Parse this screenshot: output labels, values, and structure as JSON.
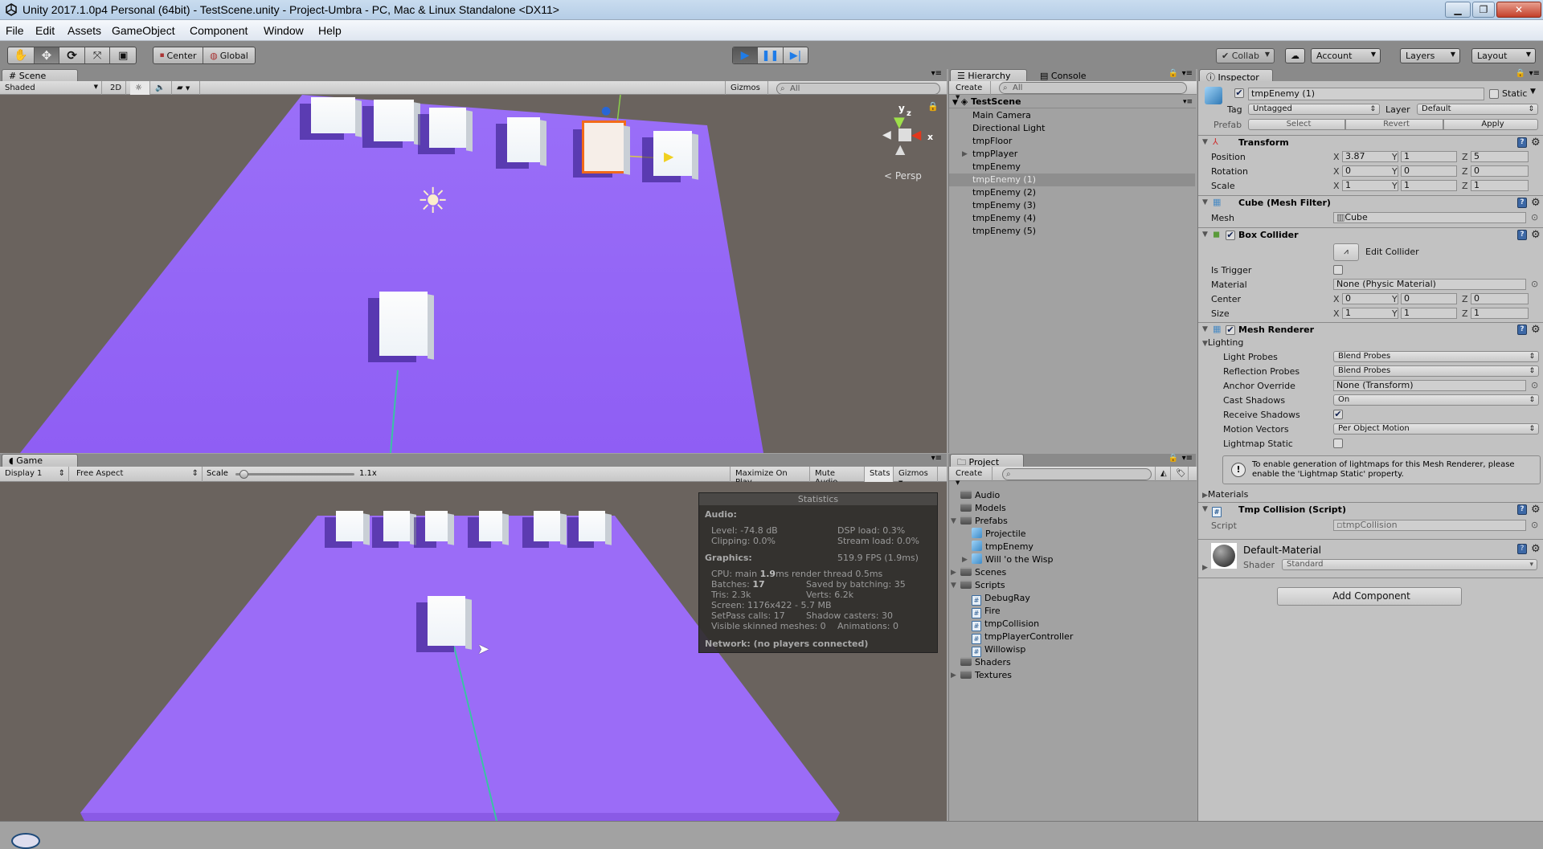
{
  "window": {
    "title": "Unity 2017.1.0p4 Personal (64bit) - TestScene.unity - Project-Umbra - PC, Mac & Linux Standalone <DX11>",
    "controls": [
      "minimize",
      "restore",
      "close"
    ]
  },
  "menu": [
    "File",
    "Edit",
    "Assets",
    "GameObject",
    "Component",
    "Window",
    "Help"
  ],
  "toolbar": {
    "transform_tools": [
      "hand-tool",
      "move-tool",
      "rotate-tool",
      "scale-tool",
      "rect-tool"
    ],
    "pivot": "Center",
    "space": "Global",
    "play": "play",
    "pause": "pause",
    "step": "step",
    "collab": "Collab",
    "account": "Account",
    "layers": "Layers",
    "layout": "Layout"
  },
  "scene": {
    "tab": "Scene",
    "shading": "Shaded",
    "mode_2d": "2D",
    "gizmos": "Gizmos",
    "search_placeholder": "All",
    "projection": "Persp",
    "axes": {
      "y": "y",
      "z": "z",
      "x": "x"
    }
  },
  "game": {
    "tab": "Game",
    "display": "Display 1",
    "aspect": "Free Aspect",
    "scale_label": "Scale",
    "scale_value": "1.1x",
    "scale_fraction": 0.05,
    "buttons": [
      "Maximize On Play",
      "Mute Audio",
      "Stats",
      "Gizmos"
    ],
    "stats": {
      "title": "Statistics",
      "audio_header": "Audio:",
      "level": "Level: -74.8 dB",
      "clipping": "Clipping: 0.0%",
      "dsp": "DSP load: 0.3%",
      "stream": "Stream load: 0.0%",
      "graphics_header": "Graphics:",
      "fps": "519.9 FPS (1.9ms)",
      "cpu_prefix": "CPU: main ",
      "cpu_main": "1.9",
      "cpu_suffix": "ms  render thread 0.5ms",
      "batches_prefix": "Batches: ",
      "batches": "17",
      "saved": "Saved by batching: 35",
      "tris": "Tris: 2.3k",
      "verts": "Verts: 6.2k",
      "screen": "Screen: 1176x422 - 5.7 MB",
      "setpass": "SetPass calls: 17",
      "shadow": "Shadow casters: 30",
      "skinned": "Visible skinned meshes: 0",
      "animations": "Animations: 0",
      "network": "Network: (no players connected)"
    }
  },
  "hierarchy": {
    "tab": "Hierarchy",
    "console_tab": "Console",
    "create": "Create",
    "search_placeholder": "All",
    "scene_name": "TestScene",
    "items": [
      {
        "label": "Main Camera",
        "expandable": false,
        "selected": false
      },
      {
        "label": "Directional Light",
        "expandable": false,
        "selected": false
      },
      {
        "label": "tmpFloor",
        "expandable": false,
        "selected": false
      },
      {
        "label": "tmpPlayer",
        "expandable": true,
        "selected": false
      },
      {
        "label": "tmpEnemy",
        "expandable": false,
        "selected": false
      },
      {
        "label": "tmpEnemy (1)",
        "expandable": false,
        "selected": true
      },
      {
        "label": "tmpEnemy (2)",
        "expandable": false,
        "selected": false
      },
      {
        "label": "tmpEnemy (3)",
        "expandable": false,
        "selected": false
      },
      {
        "label": "tmpEnemy (4)",
        "expandable": false,
        "selected": false
      },
      {
        "label": "tmpEnemy (5)",
        "expandable": false,
        "selected": false
      }
    ]
  },
  "project": {
    "tab": "Project",
    "create": "Create",
    "items": [
      {
        "label": "Audio",
        "type": "folder",
        "depth": 0,
        "arrow": ""
      },
      {
        "label": "Models",
        "type": "folder",
        "depth": 0,
        "arrow": ""
      },
      {
        "label": "Prefabs",
        "type": "folder",
        "depth": 0,
        "arrow": "open"
      },
      {
        "label": "Projectile",
        "type": "prefab",
        "depth": 1,
        "arrow": ""
      },
      {
        "label": "tmpEnemy",
        "type": "prefab",
        "depth": 1,
        "arrow": ""
      },
      {
        "label": "Will 'o the Wisp",
        "type": "prefab",
        "depth": 1,
        "arrow": "closed"
      },
      {
        "label": "Scenes",
        "type": "folder",
        "depth": 0,
        "arrow": "closed"
      },
      {
        "label": "Scripts",
        "type": "folder",
        "depth": 0,
        "arrow": "open"
      },
      {
        "label": "DebugRay",
        "type": "script",
        "depth": 1,
        "arrow": ""
      },
      {
        "label": "Fire",
        "type": "script",
        "depth": 1,
        "arrow": ""
      },
      {
        "label": "tmpCollision",
        "type": "script",
        "depth": 1,
        "arrow": ""
      },
      {
        "label": "tmpPlayerController",
        "type": "script",
        "depth": 1,
        "arrow": ""
      },
      {
        "label": "Willowisp",
        "type": "script",
        "depth": 1,
        "arrow": ""
      },
      {
        "label": "Shaders",
        "type": "folder",
        "depth": 0,
        "arrow": ""
      },
      {
        "label": "Textures",
        "type": "folder",
        "depth": 0,
        "arrow": "closed"
      }
    ]
  },
  "inspector": {
    "tab": "Inspector",
    "object_name": "tmpEnemy (1)",
    "active": true,
    "static_label": "Static",
    "static": false,
    "tag_label": "Tag",
    "tag": "Untagged",
    "layer_label": "Layer",
    "layer": "Default",
    "prefab_label": "Prefab",
    "prefab_buttons": [
      "Select",
      "Revert",
      "Apply"
    ],
    "transform": {
      "title": "Transform",
      "rows": [
        {
          "label": "Position",
          "x": "3.87",
          "y": "1",
          "z": "5"
        },
        {
          "label": "Rotation",
          "x": "0",
          "y": "0",
          "z": "0"
        },
        {
          "label": "Scale",
          "x": "1",
          "y": "1",
          "z": "1"
        }
      ]
    },
    "mesh_filter": {
      "title": "Cube (Mesh Filter)",
      "mesh_label": "Mesh",
      "mesh": "Cube"
    },
    "box_collider": {
      "title": "Box Collider",
      "enabled": true,
      "edit_label": "Edit Collider",
      "is_trigger_label": "Is Trigger",
      "is_trigger": false,
      "material_label": "Material",
      "material": "None (Physic Material)",
      "center_label": "Center",
      "center": {
        "x": "0",
        "y": "0",
        "z": "0"
      },
      "size_label": "Size",
      "size": {
        "x": "1",
        "y": "1",
        "z": "1"
      }
    },
    "mesh_renderer": {
      "title": "Mesh Renderer",
      "enabled": true,
      "lighting_label": "Lighting",
      "light_probes_label": "Light Probes",
      "light_probes": "Blend Probes",
      "reflection_probes_label": "Reflection Probes",
      "reflection_probes": "Blend Probes",
      "anchor_label": "Anchor Override",
      "anchor": "None (Transform)",
      "cast_shadows_label": "Cast Shadows",
      "cast_shadows": "On",
      "receive_shadows_label": "Receive Shadows",
      "receive_shadows": true,
      "motion_vectors_label": "Motion Vectors",
      "motion_vectors": "Per Object Motion",
      "lightmap_static_label": "Lightmap Static",
      "lightmap_static": false,
      "help": "To enable generation of lightmaps for this Mesh Renderer, please enable the 'Lightmap Static' property.",
      "materials_label": "Materials"
    },
    "script": {
      "title": "Tmp Collision (Script)",
      "script_label": "Script",
      "script": "tmpCollision"
    },
    "material": {
      "name": "Default-Material",
      "shader_label": "Shader",
      "shader": "Standard"
    },
    "add_component": "Add Component"
  },
  "colors": {
    "floor": "#9b6cf7",
    "selection_outline": "#f26a1a",
    "play_blue": "#1f7ce8",
    "panel_bg": "#c2c2c2"
  }
}
